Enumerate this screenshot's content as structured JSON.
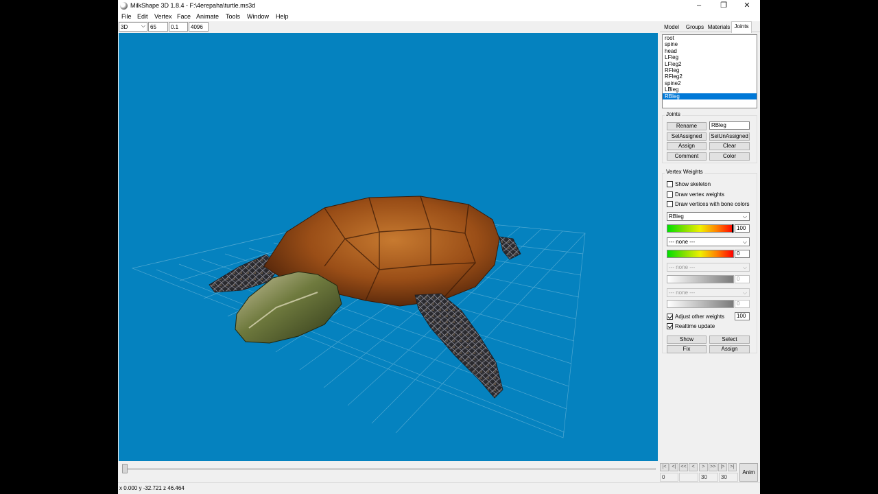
{
  "window": {
    "title": "MilkShape 3D 1.8.4 - F:\\4erepaha\\turtle.ms3d",
    "controls": {
      "minimize": "–",
      "maximize": "❐",
      "close": "✕"
    }
  },
  "menu": [
    "File",
    "Edit",
    "Vertex",
    "Face",
    "Animate",
    "Tools",
    "Window",
    "Help"
  ],
  "toolbar": {
    "view_mode": "3D",
    "field1": "65",
    "field2": "0.1",
    "field3": "4096"
  },
  "tabs": [
    {
      "label": "Model",
      "active": false
    },
    {
      "label": "Groups",
      "active": false
    },
    {
      "label": "Materials",
      "active": false
    },
    {
      "label": "Joints",
      "active": true
    }
  ],
  "joints": {
    "list": [
      "root",
      "spine",
      "head",
      "LFleg",
      "LFleg2",
      "RFleg",
      "RFleg2",
      "spine2",
      "LBleg",
      "RBleg"
    ],
    "selected": "RBleg",
    "group_title": "Joints",
    "rename_button": "Rename",
    "name_field": "RBleg",
    "sel_assigned": "SelAssigned",
    "sel_unassigned": "SelUnAssigned",
    "assign": "Assign",
    "clear": "Clear",
    "comment": "Comment",
    "color": "Color"
  },
  "vertex_weights": {
    "group_title": "Vertex Weights",
    "show_skeleton": {
      "label": "Show skeleton",
      "checked": false
    },
    "draw_vertex_weights": {
      "label": "Draw vertex weights",
      "checked": false
    },
    "draw_bone_colors": {
      "label": "Draw vertices with bone colors",
      "checked": false
    },
    "bone1": {
      "name": "RBleg",
      "weight": "100",
      "level": 1.0
    },
    "bone2": {
      "name": "--- none ---",
      "weight": "0",
      "level": 0.0
    },
    "bone3": {
      "name": "--- none ---",
      "weight": "0"
    },
    "bone4": {
      "name": "--- none ---",
      "weight": "0"
    },
    "adjust_other": {
      "label": "Adjust other weights",
      "checked": true,
      "value": "100"
    },
    "realtime_update": {
      "label": "Realtime update",
      "checked": true
    },
    "show": "Show",
    "select": "Select",
    "fix": "Fix",
    "assign": "Assign"
  },
  "animation": {
    "nav": [
      "|<",
      "<|",
      "<<",
      "<",
      ">",
      ">>",
      "|>",
      ">|"
    ],
    "current_frame": "0",
    "frame_blank": "",
    "frame_a": "30",
    "frame_b": "30",
    "anim_button": "Anim"
  },
  "status": {
    "coords": "x 0.000 y -32.721 z 46.464"
  },
  "colors": {
    "viewport_bg": "#0582bf",
    "selection": "#0078d7"
  }
}
